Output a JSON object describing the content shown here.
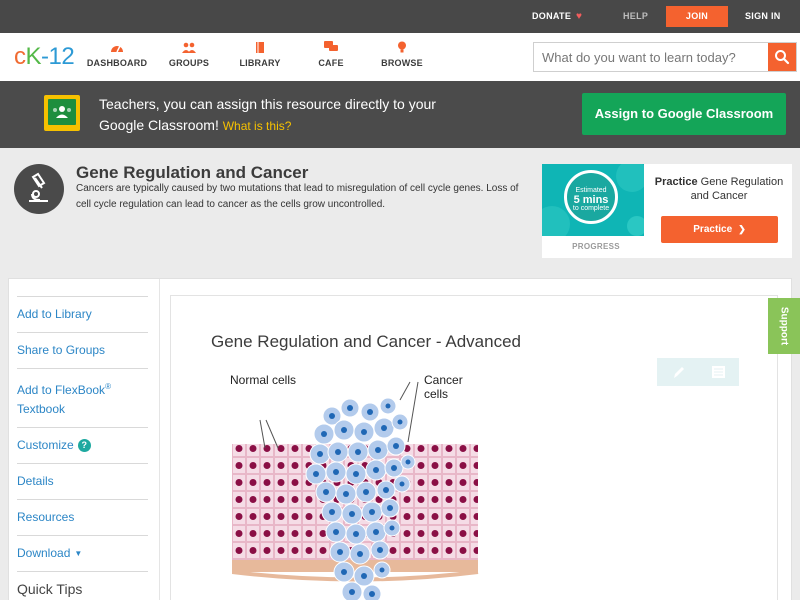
{
  "topbar": {
    "donate": "DONATE",
    "help": "HELP",
    "join": "JOIN",
    "signin": "SIGN IN"
  },
  "header": {
    "logo": {
      "c": "c",
      "k": "K",
      "n": "-12"
    },
    "nav": [
      {
        "label": "DASHBOARD",
        "icon": "dashboard-icon"
      },
      {
        "label": "GROUPS",
        "icon": "groups-icon"
      },
      {
        "label": "LIBRARY",
        "icon": "library-icon"
      },
      {
        "label": "CAFE",
        "icon": "cafe-icon"
      },
      {
        "label": "BROWSE",
        "icon": "browse-icon"
      }
    ],
    "search_placeholder": "What do you want to learn today?"
  },
  "google_classroom": {
    "text": "Teachers, you can assign this resource directly to your Google Classroom!",
    "what_is_this": "What is this?",
    "button": "Assign to Google Classroom"
  },
  "concept": {
    "title": "Gene Regulation and Cancer",
    "description": "Cancers are typically caused by two mutations that lead to misregulation of cell cycle genes. Loss of cell cycle regulation can lead to cancer as the cells grow uncontrolled."
  },
  "practice": {
    "estimated": "Estimated",
    "minutes": "5 mins",
    "to_complete": "to complete",
    "progress_label": "PROGRESS",
    "title_bold": "Practice",
    "title_rest": "Gene Regulation and Cancer",
    "button": "Practice"
  },
  "sidebar": {
    "items": [
      {
        "label": "Add to Library"
      },
      {
        "label": "Share to Groups"
      },
      {
        "label": "Add to FlexBook",
        "sup": "®",
        "line2": "Textbook"
      },
      {
        "label": "Customize"
      },
      {
        "label": "Details"
      },
      {
        "label": "Resources"
      },
      {
        "label": "Download"
      }
    ],
    "quick_tips": "Quick Tips"
  },
  "article": {
    "title": "Gene Regulation and Cancer - Advanced",
    "figure": {
      "label_normal": "Normal cells",
      "label_cancer": "Cancer cells"
    }
  },
  "support": "Support",
  "colors": {
    "accent": "#f4622f",
    "google_green": "#14a558",
    "link": "#2c86c6",
    "support_green": "#8ac459"
  }
}
